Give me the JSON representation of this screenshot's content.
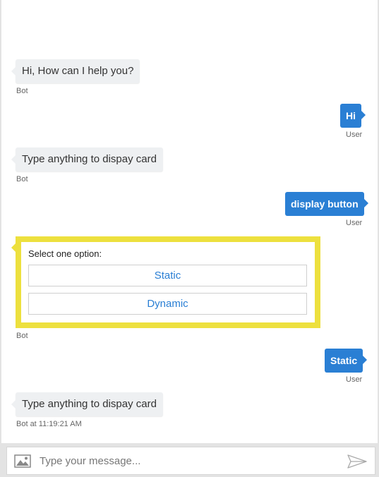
{
  "messages": [
    {
      "from": "bot",
      "text": "Hi, How can I help you?",
      "meta": "Bot"
    },
    {
      "from": "user",
      "text": "Hi",
      "meta": "User"
    },
    {
      "from": "bot",
      "text": "Type anything to dispay card",
      "meta": "Bot"
    },
    {
      "from": "user",
      "text": "display button",
      "meta": "User"
    },
    {
      "from": "bot-card",
      "meta": "Bot"
    },
    {
      "from": "user",
      "text": "Static",
      "meta": "User"
    },
    {
      "from": "bot",
      "text": "Type anything to dispay card",
      "meta": "Bot at 11:19:21 AM"
    }
  ],
  "card": {
    "title": "Select one option:",
    "options": [
      "Static",
      "Dynamic"
    ],
    "highlight_color": "#ede03e"
  },
  "composer": {
    "placeholder": "Type your message...",
    "attach_icon": "image-icon",
    "send_icon": "send-icon"
  },
  "colors": {
    "user_bubble": "#2a7fd4",
    "bot_bubble": "#eef0f2",
    "option_text": "#2a7fd4"
  }
}
